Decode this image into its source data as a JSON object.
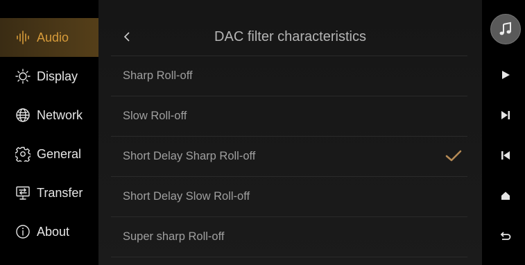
{
  "sidebar": {
    "items": [
      {
        "label": "Audio",
        "icon": "audio-bars-icon",
        "active": true
      },
      {
        "label": "Display",
        "icon": "sun-icon",
        "active": false
      },
      {
        "label": "Network",
        "icon": "globe-icon",
        "active": false
      },
      {
        "label": "General",
        "icon": "gear-icon",
        "active": false
      },
      {
        "label": "Transfer",
        "icon": "transfer-icon",
        "active": false
      },
      {
        "label": "About",
        "icon": "info-icon",
        "active": false
      }
    ]
  },
  "header": {
    "title": "DAC filter characteristics",
    "back_icon": "chevron-left-icon"
  },
  "options": [
    {
      "label": "Sharp Roll-off",
      "selected": false
    },
    {
      "label": "Slow Roll-off",
      "selected": false
    },
    {
      "label": "Short Delay Sharp Roll-off",
      "selected": true
    },
    {
      "label": "Short Delay Slow Roll-off",
      "selected": false
    },
    {
      "label": "Super sharp Roll-off",
      "selected": false
    }
  ],
  "controls": {
    "items": [
      "music-note-icon",
      "play-icon",
      "next-icon",
      "previous-icon",
      "home-icon",
      "back-icon"
    ]
  },
  "colors": {
    "accent": "#d79b3a",
    "check": "#b58a55"
  }
}
